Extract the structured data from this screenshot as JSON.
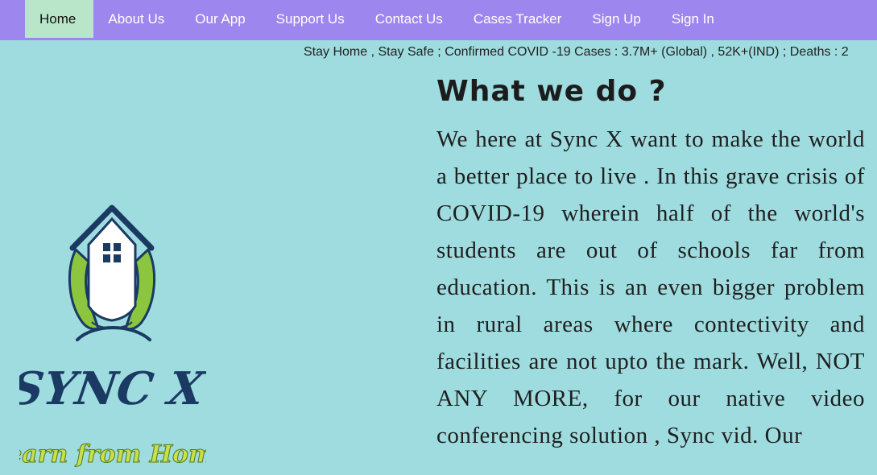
{
  "nav": {
    "items": [
      {
        "label": "Home",
        "active": true
      },
      {
        "label": "About Us",
        "active": false
      },
      {
        "label": "Our App",
        "active": false
      },
      {
        "label": "Support Us",
        "active": false
      },
      {
        "label": "Contact Us",
        "active": false
      },
      {
        "label": "Cases Tracker",
        "active": false
      },
      {
        "label": "Sign Up",
        "active": false
      },
      {
        "label": "Sign In",
        "active": false
      }
    ]
  },
  "ticker": {
    "text": "Stay Home , Stay Safe ; Confirmed COVID -19 Cases : 3.7M+ (Global) , 52K+(IND) ; Deaths : 2"
  },
  "logo": {
    "title": "SYNC X",
    "tagline": "Learn from Home"
  },
  "main": {
    "heading": "What we do ?",
    "paragraph": "We here at Sync X want to make the world a better place to live . In this grave crisis of COVID-19 wherein half of the world's students are out of schools far from education. This is an even bigger problem in rural areas where contectivity and facilities are not upto the mark. Well, NOT ANY MORE, for our native video conferencing solution , Sync vid. Our"
  },
  "colors": {
    "navbar": "#9e86ef",
    "nav_active": "#b9e6c9",
    "background": "#9fdcdf",
    "logo_navy": "#1a3a63",
    "logo_green": "#8cc63f",
    "tagline_green": "#c8e04a"
  }
}
